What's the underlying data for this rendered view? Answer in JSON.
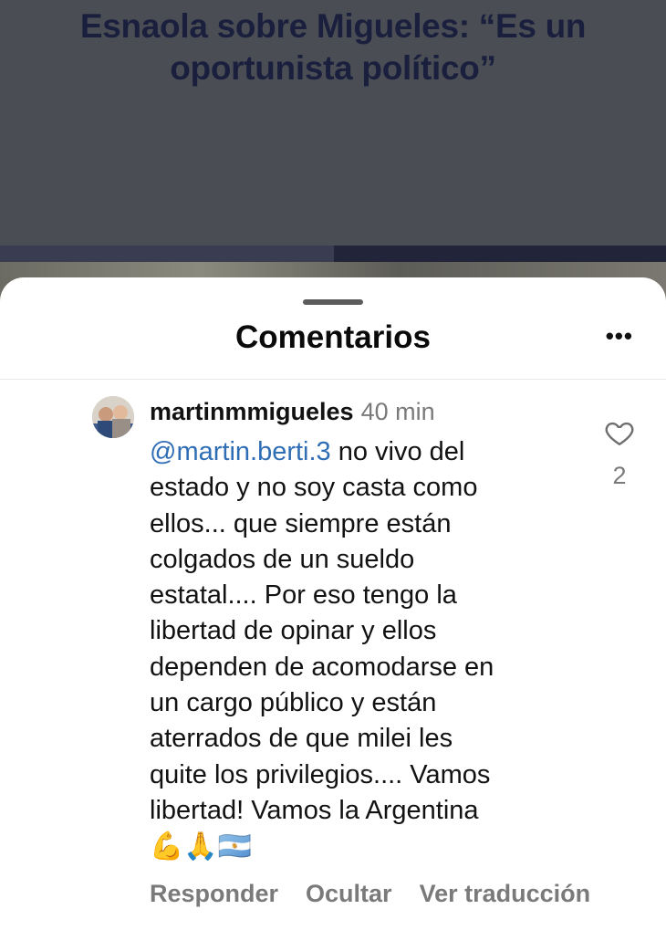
{
  "article": {
    "title": "Esnaola sobre Migueles: “Es un oportunista político”"
  },
  "sheet": {
    "title": "Comentarios",
    "menu_icon": "more-horizontal-icon"
  },
  "comment": {
    "username": "martinmmigueles",
    "time": "40 min",
    "mention": "@martin.berti.3",
    "text": " no vivo del\nestado y no soy casta como\nellos... que siempre están\ncolgados de un sueldo\nestatal.... Por eso tengo la\nlibertad de opinar y ellos\ndependen de acomodarse en\nun cargo público y están\naterrados de que milei les\nquite los privilegios.... Vamos\nlibertad! Vamos la Argentina",
    "emojis": "💪🙏🇦🇷",
    "likes": "2",
    "actions": {
      "reply": "Responder",
      "hide": "Ocultar",
      "translate": "Ver traducción"
    }
  },
  "colors": {
    "mention": "#2f6eb5",
    "secondary_text": "#7a7a7a",
    "backdrop": "#4a4e54"
  }
}
